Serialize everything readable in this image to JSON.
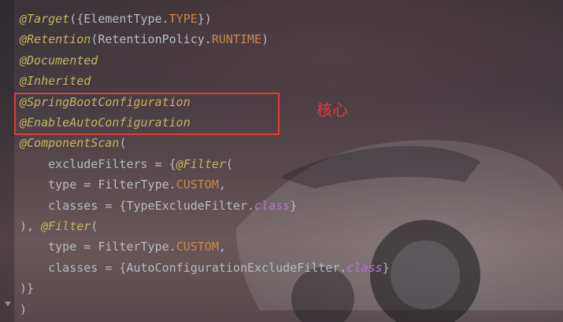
{
  "code_lines": [
    [
      [
        "annot",
        "@Target"
      ],
      [
        "plain",
        "({ElementType."
      ],
      [
        "const",
        "TYPE"
      ],
      [
        "plain",
        "})"
      ]
    ],
    [
      [
        "annot",
        "@Retention"
      ],
      [
        "plain",
        "(RetentionPolicy."
      ],
      [
        "const",
        "RUNTIME"
      ],
      [
        "plain",
        ")"
      ]
    ],
    [
      [
        "annot",
        "@Documented"
      ]
    ],
    [
      [
        "annot",
        "@Inherited"
      ]
    ],
    [
      [
        "annot",
        "@SpringBootConfiguration"
      ]
    ],
    [
      [
        "annot",
        "@EnableAutoConfiguration"
      ]
    ],
    [
      [
        "annot",
        "@ComponentScan"
      ],
      [
        "plain",
        "("
      ]
    ],
    [
      [
        "plain",
        "    excludeFilters = {"
      ],
      [
        "annot",
        "@Filter"
      ],
      [
        "plain",
        "("
      ]
    ],
    [
      [
        "plain",
        "    type = FilterType."
      ],
      [
        "const",
        "CUSTOM"
      ],
      [
        "plain",
        ","
      ]
    ],
    [
      [
        "plain",
        "    classes = {TypeExcludeFilter."
      ],
      [
        "kw",
        "class"
      ],
      [
        "plain",
        "}"
      ]
    ],
    [
      [
        "plain",
        "), "
      ],
      [
        "annot",
        "@Filter"
      ],
      [
        "plain",
        "("
      ]
    ],
    [
      [
        "plain",
        "    type = FilterType."
      ],
      [
        "const",
        "CUSTOM"
      ],
      [
        "plain",
        ","
      ]
    ],
    [
      [
        "plain",
        "    classes = {AutoConfigurationExcludeFilter."
      ],
      [
        "kw",
        "class"
      ],
      [
        "plain",
        "}"
      ]
    ],
    [
      [
        "plain",
        ")}"
      ]
    ],
    [
      [
        "plain",
        ")"
      ]
    ]
  ],
  "annotation": {
    "note_text": "核心",
    "box_color": "#e23b3b"
  },
  "icons": [
    "fold-marker-icon"
  ]
}
